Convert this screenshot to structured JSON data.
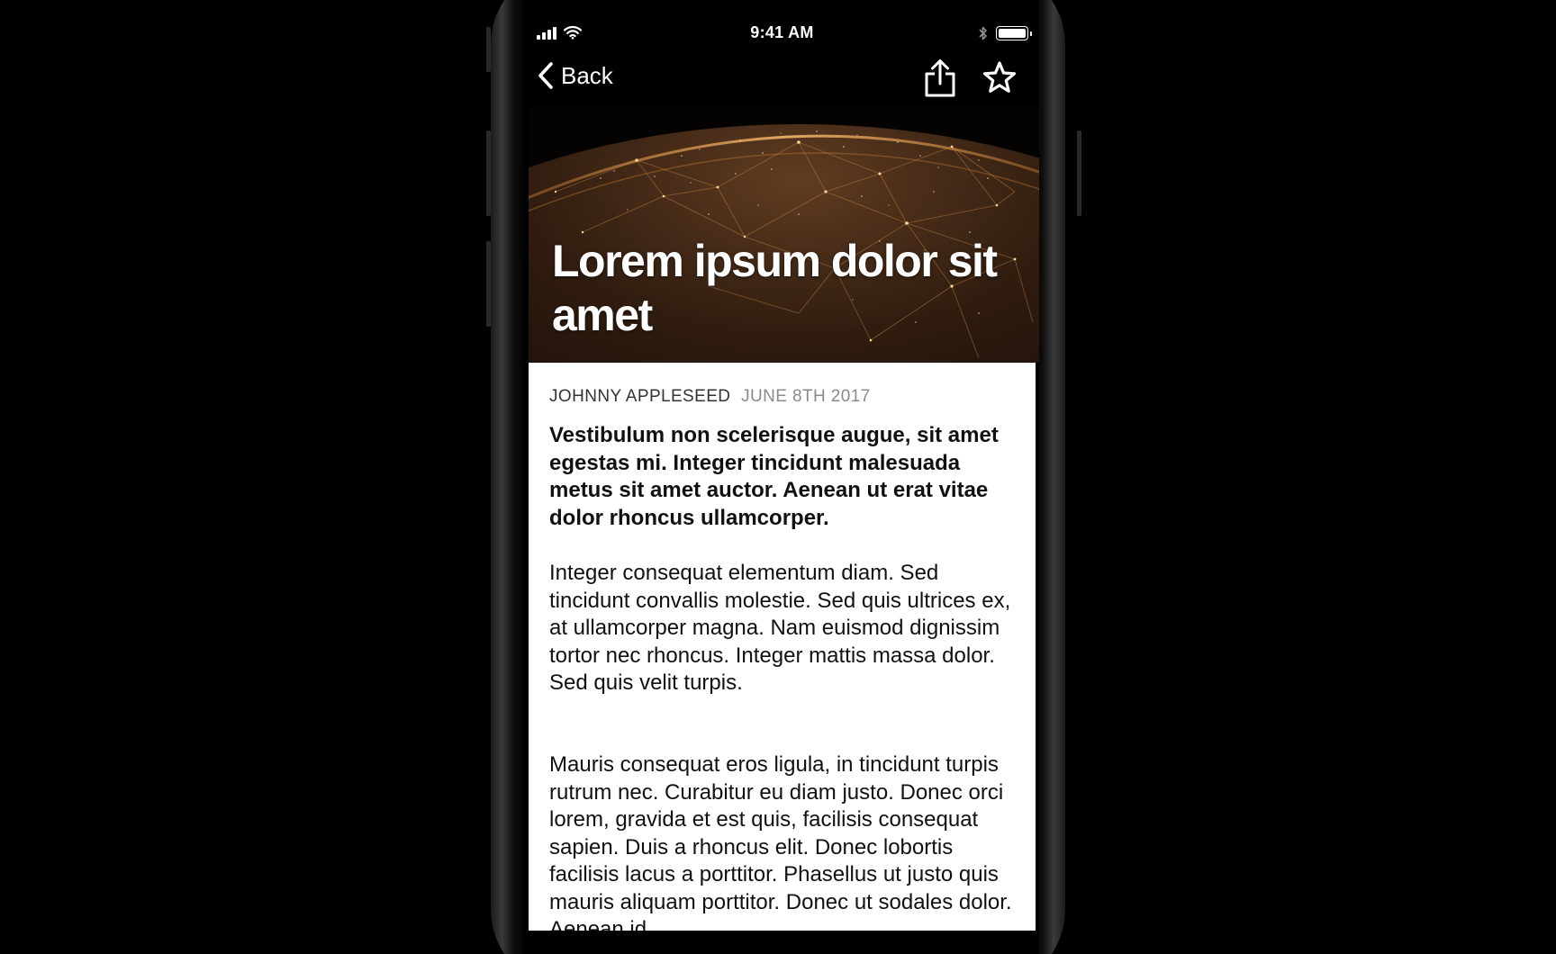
{
  "status_bar": {
    "time": "9:41 AM",
    "signal_bars": 4,
    "wifi_icon": "wifi-icon",
    "bluetooth_icon": "bluetooth-icon",
    "battery_level": 1.0
  },
  "nav": {
    "back_label": "Back",
    "back_icon": "chevron-left-icon",
    "share_icon": "share-icon",
    "favorite_icon": "star-icon"
  },
  "hero": {
    "title": "Lorem ipsum dolor sit amet",
    "background_icon": "earth-network-image"
  },
  "article": {
    "author": "JOHNNY APPLESEED",
    "date": "JUNE 8TH 2017",
    "lede": "Vestibulum non scelerisque augue, sit amet egestas mi. Integer tincidunt malesuada metus sit amet auctor. Aenean ut erat vitae dolor rhoncus ullamcorper.",
    "paragraphs": [
      "Integer consequat elementum diam. Sed tincidunt convallis molestie. Sed quis ultrices ex, at ullamcorper magna. Nam euismod dignissim tortor nec rhoncus. Integer mattis massa dolor. Sed quis velit turpis.",
      "Mauris consequat eros ligula, in tincidunt turpis rutrum nec. Curabitur eu diam justo. Donec orci lorem, gravida et est quis, facilisis consequat sapien. Duis a rhoncus elit. Donec lobortis facilisis lacus a porttitor. Phasellus ut justo quis mauris aliquam porttitor. Donec ut sodales dolor. Aenean id"
    ]
  },
  "colors": {
    "background": "#000000",
    "article_background": "#ffffff",
    "text_primary": "#111111",
    "text_secondary": "#8a8a8a",
    "hero_glow": "#e08a3a"
  }
}
